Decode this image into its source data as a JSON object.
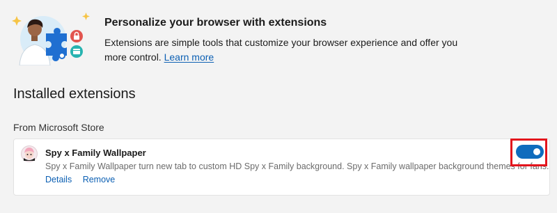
{
  "promo": {
    "title": "Personalize your browser with extensions",
    "description": "Extensions are simple tools that customize your browser experience and offer you more control.",
    "learn_more": "Learn more"
  },
  "installed": {
    "heading": "Installed extensions",
    "source_label": "From Microsoft Store"
  },
  "extension": {
    "name": "Spy x Family Wallpaper",
    "description": "Spy x Family Wallpaper turn new tab to custom HD Spy x Family background. Spy x Family wallpaper background themes for fans.",
    "details_label": "Details",
    "remove_label": "Remove",
    "enabled": true
  },
  "colors": {
    "accent": "#0f6cbd",
    "link": "#0b5fb3",
    "highlight": "#e3141c",
    "background": "#f3f3f3"
  },
  "icons": {
    "promo_illustration": "person-with-puzzle-illustration",
    "extension_icon": "spy-x-family-icon"
  }
}
